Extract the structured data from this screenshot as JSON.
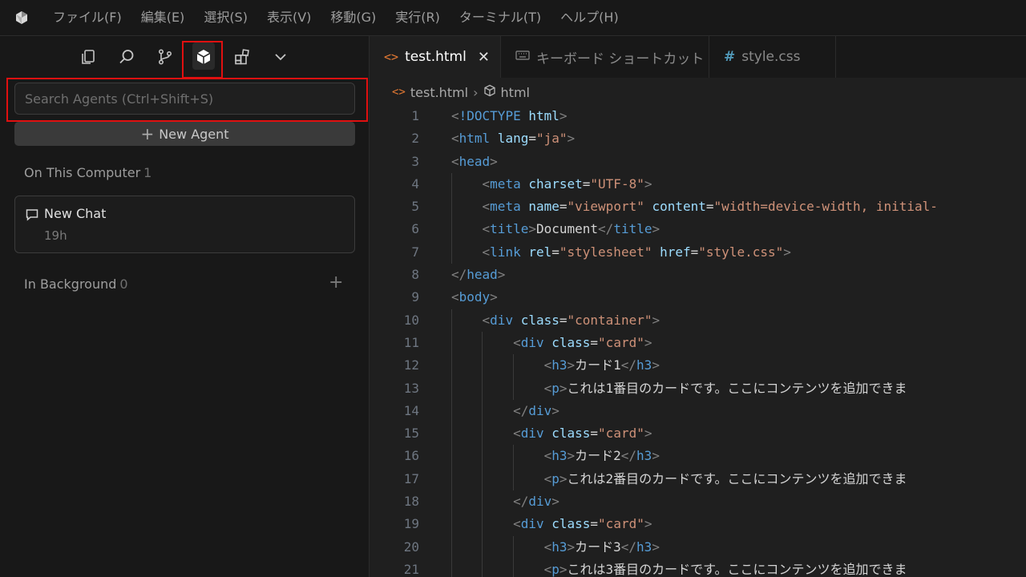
{
  "menubar": {
    "items": [
      "ファイル(F)",
      "編集(E)",
      "選択(S)",
      "表示(V)",
      "移動(G)",
      "実行(R)",
      "ターミナル(T)",
      "ヘルプ(H)"
    ]
  },
  "activity_bar": {
    "icons": [
      "explorer-icon",
      "search-icon",
      "source-control-icon",
      "agents-icon",
      "extensions-icon",
      "chevron-down-icon"
    ],
    "active": "agents-icon"
  },
  "agents_panel": {
    "search_placeholder": "Search Agents (Ctrl+Shift+S)",
    "new_agent_label": "New Agent",
    "on_this_computer": {
      "label": "On This Computer",
      "count": "1"
    },
    "chats": [
      {
        "title": "New Chat",
        "time": "19h"
      }
    ],
    "in_background": {
      "label": "In Background",
      "count": "0"
    }
  },
  "tabs": [
    {
      "label": "test.html",
      "active": true,
      "icon": "html-file-icon"
    },
    {
      "label": "キーボード ショートカット",
      "active": false,
      "icon": "keyboard-icon"
    },
    {
      "label": "style.css",
      "active": false,
      "icon": "css-file-icon"
    }
  ],
  "breadcrumb": {
    "file": "test.html",
    "symbol": "html"
  },
  "code": {
    "line_numbers": [
      "1",
      "2",
      "3",
      "4",
      "5",
      "6",
      "7",
      "8",
      "9",
      "10",
      "11",
      "12",
      "13",
      "14",
      "15",
      "16",
      "17",
      "18",
      "19",
      "20",
      "21"
    ],
    "lines": [
      "<!DOCTYPE html>",
      "<html lang=\"ja\">",
      "<head>",
      "    <meta charset=\"UTF-8\">",
      "    <meta name=\"viewport\" content=\"width=device-width, initial-",
      "    <title>Document</title>",
      "    <link rel=\"stylesheet\" href=\"style.css\">",
      "</head>",
      "<body>",
      "    <div class=\"container\">",
      "        <div class=\"card\">",
      "            <h3>カード1</h3>",
      "            <p>これは1番目のカードです。ここにコンテンツを追加できま",
      "        </div>",
      "        <div class=\"card\">",
      "            <h3>カード2</h3>",
      "            <p>これは2番目のカードです。ここにコンテンツを追加できま",
      "        </div>",
      "        <div class=\"card\">",
      "            <h3>カード3</h3>",
      "            <p>これは3番目のカードです。ここにコンテンツを追加できま"
    ]
  },
  "colors": {
    "highlight": "#e01010",
    "accent_html": "#e37933",
    "accent_css": "#519aba"
  }
}
